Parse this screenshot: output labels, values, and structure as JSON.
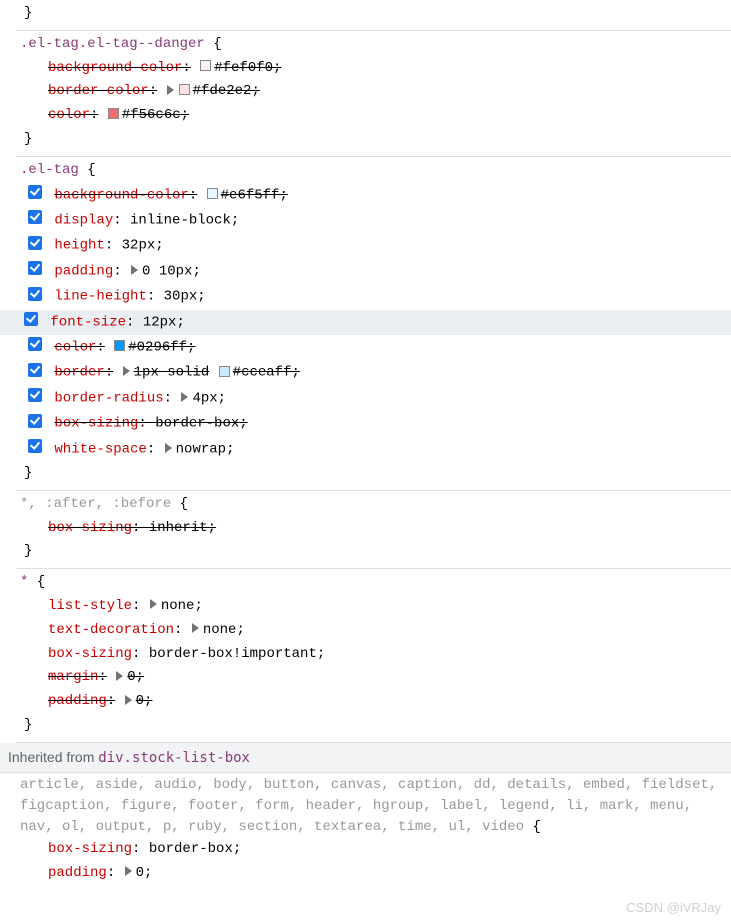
{
  "rules": [
    {
      "selector": "",
      "decls": [],
      "trailingBraceOnly": true
    },
    {
      "selector": ".el-tag.el-tag--danger",
      "decls": [
        {
          "name": "background-color",
          "value": "#fef0f0",
          "strike": true,
          "swatch": "#fef0f0"
        },
        {
          "name": "border-color",
          "value": "#fde2e2",
          "strike": true,
          "triangle": true,
          "swatch": "#fde2e2"
        },
        {
          "name": "color",
          "value": "#f56c6c",
          "strike": true,
          "swatch": "#f56c6c"
        }
      ]
    },
    {
      "selector": ".el-tag",
      "checks": true,
      "decls": [
        {
          "check": true,
          "name": "background-color",
          "value": "#e6f5ff",
          "strike": true,
          "swatch": "#e6f5ff"
        },
        {
          "check": true,
          "name": "display",
          "value": "inline-block"
        },
        {
          "check": true,
          "name": "height",
          "value": "32px"
        },
        {
          "check": true,
          "name": "padding",
          "value": "0 10px",
          "triangle": true
        },
        {
          "check": true,
          "name": "line-height",
          "value": "30px"
        },
        {
          "check": true,
          "name": "font-size",
          "value": "12px",
          "highlighted": true
        },
        {
          "check": true,
          "name": "color",
          "value": "#0296ff",
          "strike": true,
          "swatch": "#0296ff"
        },
        {
          "check": true,
          "name": "border",
          "value": "1px solid  #cceaff",
          "strike": true,
          "triangle": true,
          "swatch": "#cceaff",
          "swatchAfterText": "1px solid"
        },
        {
          "check": true,
          "name": "border-radius",
          "value": "4px",
          "triangle": true
        },
        {
          "check": true,
          "name": "box-sizing",
          "value": "border-box",
          "strike": true
        },
        {
          "check": true,
          "name": "white-space",
          "value": "nowrap",
          "triangle": true
        }
      ]
    },
    {
      "selector": "*, :after, :before",
      "selectorGray": true,
      "decls": [
        {
          "name": "box-sizing",
          "value": "inherit",
          "strike": true
        }
      ]
    },
    {
      "selector": "*",
      "decls": [
        {
          "name": "list-style",
          "value": "none",
          "triangle": true
        },
        {
          "name": "text-decoration",
          "value": "none",
          "triangle": true
        },
        {
          "name": "box-sizing",
          "value": "border-box!important"
        },
        {
          "name": "margin",
          "value": "0",
          "strike": true,
          "triangle": true
        },
        {
          "name": "padding",
          "value": "0",
          "strike": true,
          "triangle": true
        }
      ]
    }
  ],
  "inherited": {
    "label": "Inherited from ",
    "element": "div.stock-list-box"
  },
  "inheritedRule": {
    "selector": "article, aside, audio, body, button, canvas, caption, dd, details, embed, fieldset, figcaption, figure, footer, form, header, hgroup, label, legend, li, mark, menu, nav, ol, output, p, ruby, section, textarea, time, ul, video",
    "decls": [
      {
        "name": "box-sizing",
        "value": "border-box"
      },
      {
        "name": "padding",
        "value": "0",
        "triangle": true
      }
    ]
  },
  "watermark": "CSDN @iVRJay"
}
